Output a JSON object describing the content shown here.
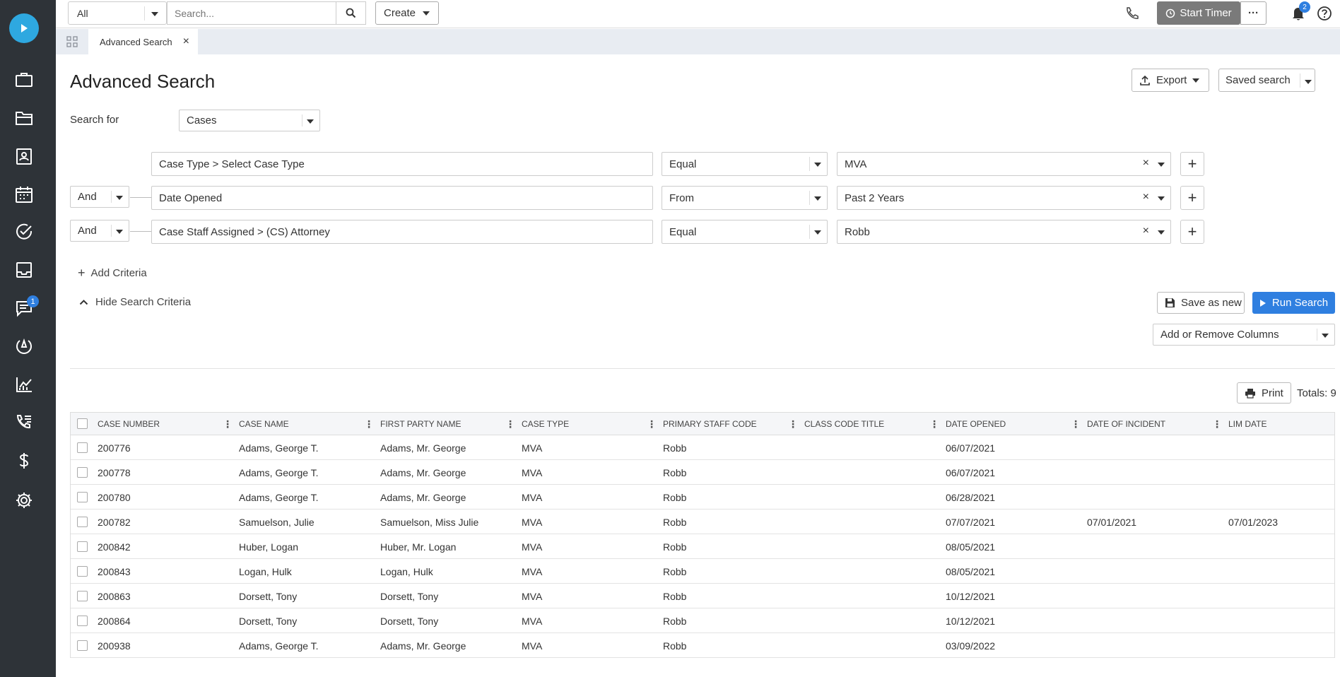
{
  "topbar": {
    "scope_value": "All",
    "search_placeholder": "Search...",
    "create_label": "Create",
    "timer_label": "Start Timer",
    "more_label": "···",
    "notifications_count": "2"
  },
  "rail": {
    "messages_badge": "1",
    "icons": [
      "play-logo-icon",
      "briefcase-icon",
      "folder-icon",
      "contacts-icon",
      "calendar-icon",
      "tasks-check-icon",
      "inbox-icon",
      "messages-icon",
      "intake-icon",
      "reports-chart-icon",
      "call-log-icon",
      "billing-dollar-icon",
      "settings-gear-icon"
    ]
  },
  "tabs": [
    {
      "label": "Advanced Search"
    }
  ],
  "page": {
    "title": "Advanced Search",
    "export_label": "Export",
    "saved_search_label": "Saved search",
    "search_for_label": "Search for",
    "search_for_value": "Cases",
    "add_criteria_label": "Add Criteria",
    "hide_criteria_label": "Hide Search Criteria",
    "save_as_new_label": "Save as new",
    "run_search_label": "Run Search",
    "columns_label": "Add or Remove Columns",
    "print_label": "Print",
    "totals_label": "Totals: 9"
  },
  "criteria": [
    {
      "conjunction": "",
      "field": "Case Type > Select Case Type",
      "operator": "Equal",
      "value": "MVA"
    },
    {
      "conjunction": "And",
      "field": "Date Opened",
      "operator": "From",
      "value": "Past 2 Years"
    },
    {
      "conjunction": "And",
      "field": "Case Staff Assigned > (CS) Attorney",
      "operator": "Equal",
      "value": "Robb"
    }
  ],
  "table": {
    "columns": [
      "CASE NUMBER",
      "CASE NAME",
      "FIRST PARTY NAME",
      "CASE TYPE",
      "PRIMARY STAFF CODE",
      "CLASS CODE TITLE",
      "DATE OPENED",
      "DATE OF INCIDENT",
      "LIM DATE"
    ],
    "rows": [
      [
        "200776",
        "Adams, George T.",
        "Adams, Mr. George",
        "MVA",
        "Robb",
        "",
        "06/07/2021",
        "",
        ""
      ],
      [
        "200778",
        "Adams, George T.",
        "Adams, Mr. George",
        "MVA",
        "Robb",
        "",
        "06/07/2021",
        "",
        ""
      ],
      [
        "200780",
        "Adams, George T.",
        "Adams, Mr. George",
        "MVA",
        "Robb",
        "",
        "06/28/2021",
        "",
        ""
      ],
      [
        "200782",
        "Samuelson, Julie",
        "Samuelson, Miss Julie",
        "MVA",
        "Robb",
        "",
        "07/07/2021",
        "07/01/2021",
        "07/01/2023"
      ],
      [
        "200842",
        "Huber, Logan",
        "Huber, Mr. Logan",
        "MVA",
        "Robb",
        "",
        "08/05/2021",
        "",
        ""
      ],
      [
        "200843",
        "Logan, Hulk",
        "Logan, Hulk",
        "MVA",
        "Robb",
        "",
        "08/05/2021",
        "",
        ""
      ],
      [
        "200863",
        "Dorsett, Tony",
        "Dorsett, Tony",
        "MVA",
        "Robb",
        "",
        "10/12/2021",
        "",
        ""
      ],
      [
        "200864",
        "Dorsett, Tony",
        "Dorsett, Tony",
        "MVA",
        "Robb",
        "",
        "10/12/2021",
        "",
        ""
      ],
      [
        "200938",
        "Adams, George T.",
        "Adams, Mr. George",
        "MVA",
        "Robb",
        "",
        "03/09/2022",
        "",
        ""
      ]
    ]
  },
  "colors": {
    "rail_bg": "#2e3338",
    "accent": "#2f7fe0",
    "logo": "#2ea8e0",
    "timer_bg": "#7a7a7a"
  }
}
